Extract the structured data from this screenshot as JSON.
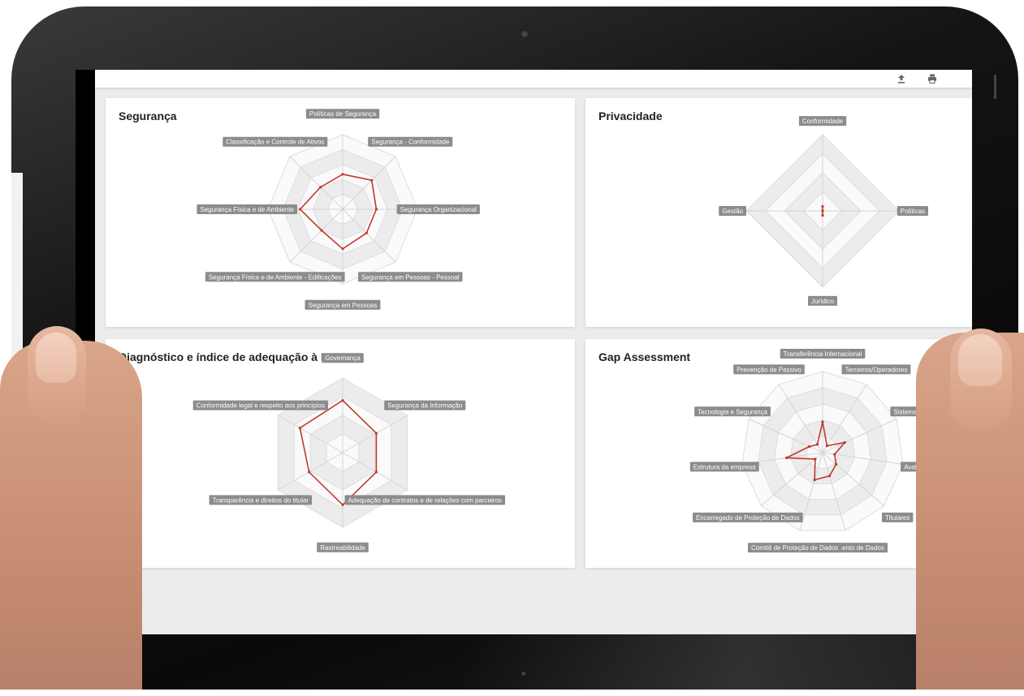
{
  "toolbar": {
    "export_icon": "upload-icon",
    "print_icon": "print-icon"
  },
  "colors": {
    "series": "#c0392b",
    "ring_shade": "#ececec",
    "label_bg": "#8c8c8c"
  },
  "charts": [
    {
      "id": "seguranca",
      "title": "Segurança",
      "chart_data": {
        "type": "radar",
        "levels": 5,
        "axes": [
          "Políticas de Segurança",
          "Segurança - Conformidade",
          "Segurança Organizacional",
          "Segurança em Pessoas - Pessoal",
          "Segurança em Pessoas",
          "Segurança Física e de Ambiente - Edificações",
          "Segurança Física e de Ambiente",
          "Classificação e Controle de Ativos"
        ],
        "values": [
          0.47,
          0.55,
          0.45,
          0.45,
          0.53,
          0.4,
          0.57,
          0.42
        ]
      }
    },
    {
      "id": "privacidade",
      "title": "Privacidade",
      "chart_data": {
        "type": "radar",
        "levels": 4,
        "axes": [
          "Conformidade",
          "Políticas",
          "Jurídico",
          "Gestão"
        ],
        "values": [
          0.06,
          0.0,
          0.06,
          0.0
        ]
      }
    },
    {
      "id": "lgpd",
      "title": "Diagnóstico e índice de adequação à LGPD",
      "chart_data": {
        "type": "radar",
        "levels": 4,
        "axes": [
          "Governança",
          "Segurança da Informação",
          "Adequação de contratos e de relações com parceiros",
          "Rastreabilidade",
          "Transparência e direitos do titular",
          "Conformidade legal e respeito aos princípios"
        ],
        "values": [
          0.7,
          0.52,
          0.52,
          0.7,
          0.52,
          0.66
        ]
      }
    },
    {
      "id": "gap",
      "title": "Gap Assessment",
      "chart_data": {
        "type": "radar",
        "levels": 5,
        "axes": [
          "Transferência Internacional",
          "Terceiros/Operadores",
          "Sistemas e P",
          "Avaliação d",
          "Titulares",
          "Mapeamento de Dados",
          "Comitê de Proteção de Dados",
          "Encarregado de Proteção de Dados",
          "Estrutura da empresa",
          "Tecnologia e Segurança",
          "Prevenção de Passivo"
        ],
        "values": [
          0.38,
          0.1,
          0.3,
          0.15,
          0.22,
          0.3,
          0.35,
          0.12,
          0.45,
          0.18,
          0.12
        ]
      }
    }
  ]
}
